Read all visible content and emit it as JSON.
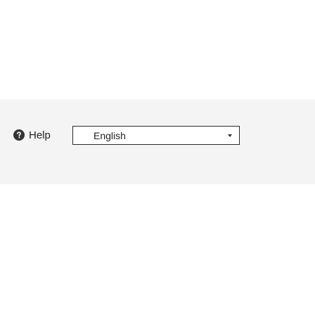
{
  "footer": {
    "help": {
      "label": "Help",
      "icon": "help-icon"
    },
    "language": {
      "selected": "English",
      "icon": "chevron-down-icon"
    }
  }
}
